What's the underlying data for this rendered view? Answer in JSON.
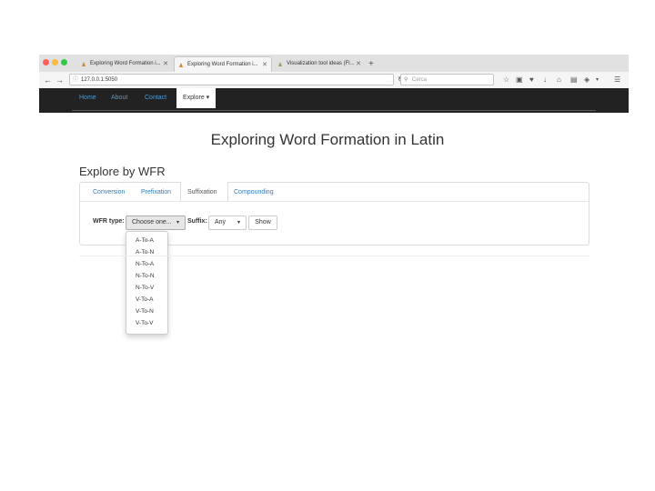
{
  "browser": {
    "tabs": [
      {
        "title": "Exploring Word Formation i...",
        "close": "✕"
      },
      {
        "title": "Exploring Word Formation i...",
        "close": "✕"
      },
      {
        "title": "Visualization tool ideas (Fl...",
        "close": "✕"
      }
    ],
    "new_tab": "+",
    "url": "127.0.0.1:5050",
    "search_placeholder": "Cerca",
    "colors": {
      "close": "#fc605c",
      "minimize": "#fdbc40",
      "maximize": "#34c84a"
    }
  },
  "site_nav": {
    "items": [
      "Home",
      "About",
      "Contact"
    ],
    "active": "Explore ▾"
  },
  "page": {
    "title": "Exploring Word Formation in Latin",
    "section": "Explore by WFR",
    "tabs": [
      "Conversion",
      "Prefixation",
      "Suffixation",
      "Compounding"
    ],
    "form": {
      "wfr_label": "WFR type:",
      "wfr_value": "Choose one...",
      "suffix_label": "Suffix:",
      "suffix_value": "Any",
      "show_button": "Show",
      "caret": "▾"
    },
    "dropdown_options": [
      "A-To-A",
      "A-To-N",
      "N-To-A",
      "N-To-N",
      "N-To-V",
      "V-To-A",
      "V-To-N",
      "V-To-V"
    ]
  }
}
